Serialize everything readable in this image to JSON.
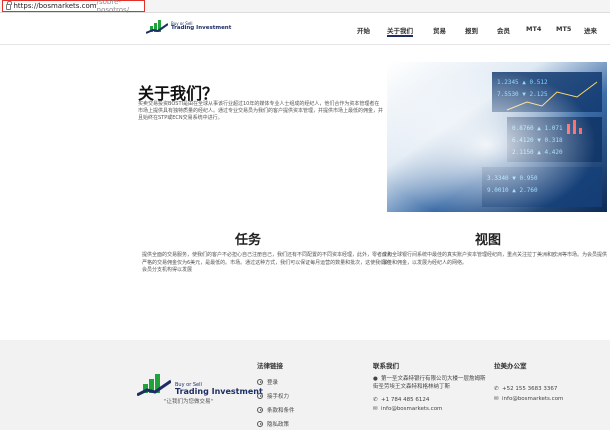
{
  "browser": {
    "url_host": "https://bosmarkets.com",
    "url_path": "/sobre-nosotros/"
  },
  "header": {
    "logo_small": "Buy or Sell",
    "logo_big": "Trading Investment",
    "nav": [
      {
        "label": "开始",
        "active": false
      },
      {
        "label": "关于我们",
        "active": true
      },
      {
        "label": "贸易",
        "active": false
      },
      {
        "label": "报到",
        "active": false
      },
      {
        "label": "会员",
        "active": false
      },
      {
        "label": "MT4",
        "active": false
      },
      {
        "label": "MT5",
        "active": false
      },
      {
        "label": "进来",
        "active": false
      }
    ]
  },
  "about": {
    "title": "关于我们？",
    "text": "买卖交易投资BOSTI是由在全球从事该行业超过10年的媒体专业人士组成的经纪人，他们合作为资本管理者在市场上提供具有独特质量的经纪人。通过专业交易员为我们的客户提供资本管理，并提供市场上最低的佣金，并且始终在STP或ECN交易系统中进行。"
  },
  "mission": {
    "title": "任务",
    "text": "提供全面的交易服务，使我们的客户不必担心自己注册自己，我们还有不同配置的不同资本经理，此外，零者价和严格的交易佣金仅为6美元，是最低的。市场。通过这种方式，我们可以保证每月运营的数量和批次，这使我们的会员分支机构得以发展"
  },
  "vision": {
    "title": "视图",
    "text": "成为全球银行间系统中最佳的真实账户资本管理经纪商，重点关注拉丁美洲和欧洲等市场。为会员提供最佳和佣金，以发展为经纪人的网络。"
  },
  "footer": {
    "logo_small": "Buy or Sell",
    "logo_big": "Trading Investment",
    "slogan": "\"让我们为您做交易\"",
    "legal": {
      "title": "法律链接",
      "links": [
        "登录",
        "接手权力",
        "条款和条件",
        "隐私政策"
      ]
    },
    "contact": {
      "title": "联系我们",
      "address": "第一圣文森特银行有限公司大楼一层詹姆斯街圣劳埃王文森特和格林纳丁斯",
      "phone": "+1 784 485 6124",
      "email": "info@bosmarkets.com"
    },
    "latam": {
      "title": "拉美办公室",
      "phone": "+52 155 3683 3367",
      "email": "info@bosmarkets.com"
    }
  }
}
